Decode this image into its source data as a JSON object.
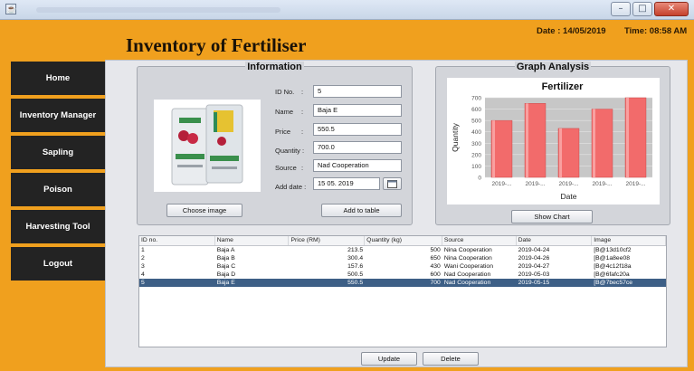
{
  "window": {
    "app_icon": "java-icon"
  },
  "header": {
    "title": "Inventory of Fertiliser",
    "date": "Date : 14/05/2019",
    "time": "Time: 08:58 AM"
  },
  "sidebar": {
    "items": [
      {
        "label": "Home"
      },
      {
        "label": "Inventory Manager"
      },
      {
        "label": "Sapling"
      },
      {
        "label": "Poison"
      },
      {
        "label": "Harvesting Tool"
      },
      {
        "label": "Logout"
      }
    ]
  },
  "information": {
    "title": "Information",
    "choose_image_label": "Choose image",
    "add_to_table_label": "Add to table",
    "fields": {
      "id_label": "ID No.",
      "id_value": "5",
      "name_label": "Name",
      "name_value": "Baja E",
      "price_label": "Price",
      "price_value": "550.5",
      "quantity_label": "Quantity :",
      "quantity_value": "700.0",
      "source_label": "Source",
      "source_value": "Nad Cooperation",
      "add_date_label": "Add date :",
      "add_date_value": "15 05. 2019",
      "colon": ":"
    }
  },
  "graph": {
    "title": "Graph Analysis",
    "show_chart_label": "Show Chart"
  },
  "chart_data": {
    "type": "bar",
    "title": "Fertilizer",
    "xlabel": "Date",
    "ylabel": "Quantity",
    "categories": [
      "2019-...",
      "2019-...",
      "2019-...",
      "2019-...",
      "2019-..."
    ],
    "values": [
      500,
      650,
      430,
      600,
      700
    ],
    "ylim": [
      0,
      700
    ],
    "yticks": [
      "0",
      "100",
      "200",
      "300",
      "400",
      "500",
      "600",
      "700"
    ],
    "bar_color": "#f26b6b",
    "grid": true
  },
  "table": {
    "columns": [
      "ID no.",
      "Name",
      "Price (RM)",
      "Quantity (kg)",
      "Source",
      "Date",
      "Image"
    ],
    "rows": [
      [
        "1",
        "Baja A",
        "213.5",
        "500",
        "Nina Cooperation",
        "2019-04-24",
        "[B@13d10cf2"
      ],
      [
        "2",
        "Baja B",
        "300.4",
        "650",
        "Nina Cooperation",
        "2019-04-26",
        "[B@1a8ee08"
      ],
      [
        "3",
        "Baja C",
        "157.6",
        "430",
        "Wani Cooperation",
        "2019-04-27",
        "[B@4c12f18a"
      ],
      [
        "4",
        "Baja D",
        "500.5",
        "600",
        "Nad Cooperation",
        "2019-05-03",
        "[B@6fafc20a"
      ],
      [
        "5",
        "Baja E",
        "550.5",
        "700",
        "Nad Cooperation",
        "2019-05-15",
        "[B@7bec57ce"
      ]
    ],
    "selected_row": 4
  },
  "actions": {
    "update_label": "Update",
    "delete_label": "Delete"
  },
  "colors": {
    "accent": "#f0a01e",
    "sidebar_bg": "#232323",
    "selected_row": "#3d5f86"
  }
}
